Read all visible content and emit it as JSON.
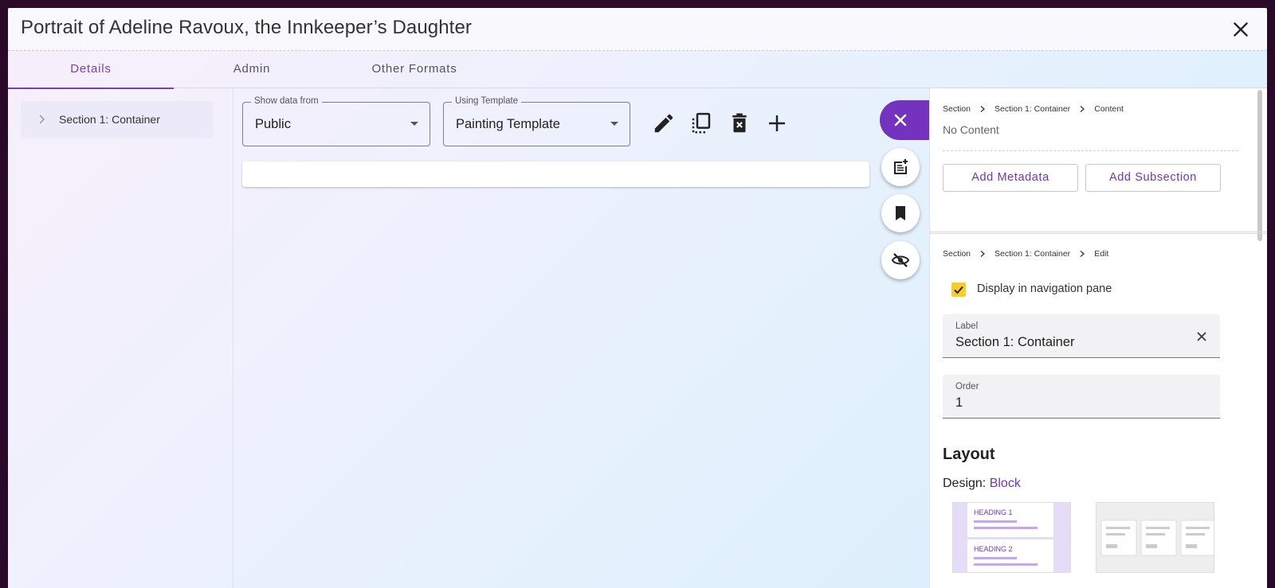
{
  "header": {
    "title": "Portrait of Adeline Ravoux, the Innkeeper’s Daughter"
  },
  "tabs": [
    {
      "label": "Details",
      "active": true
    },
    {
      "label": "Admin",
      "active": false
    },
    {
      "label": "Other Formats",
      "active": false
    }
  ],
  "nav": {
    "items": [
      {
        "label": "Section 1: Container"
      }
    ]
  },
  "toolbar": {
    "show_data_from": {
      "label": "Show data from",
      "value": "Public"
    },
    "using_template": {
      "label": "Using Template",
      "value": "Painting Template"
    }
  },
  "right_panel": {
    "content_card": {
      "breadcrumb": [
        "Section",
        "Section 1: Container",
        "Content"
      ],
      "no_content": "No Content",
      "add_metadata": "Add Metadata",
      "add_subsection": "Add Subsection"
    },
    "edit_card": {
      "breadcrumb": [
        "Section",
        "Section 1: Container",
        "Edit"
      ],
      "display_in_nav_label": "Display in navigation pane",
      "display_in_nav_checked": true,
      "label_field": {
        "label": "Label",
        "value": "Section 1: Container"
      },
      "order_field": {
        "label": "Order",
        "value": "1"
      },
      "layout_heading": "Layout",
      "design_label": "Design:",
      "design_value": "Block",
      "thumb_block_headings": [
        "HEADING 1",
        "HEADING 2"
      ]
    }
  },
  "colors": {
    "accent": "#7433bf",
    "checkbox": "#f7cd2a"
  }
}
